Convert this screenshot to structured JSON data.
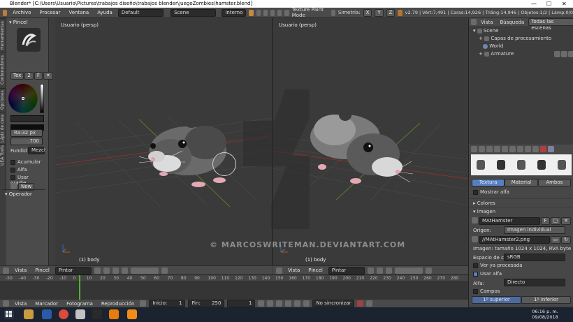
{
  "title_bar": {
    "text": "Blender* [C:\\Users\\Usuario\\Pictures\\trabajos diseño\\trabajos blender\\juegoZombies\\hamster.blend]",
    "minimize": "—",
    "maximize": "☐",
    "close": "✕"
  },
  "info_header": {
    "menus": [
      "Archivo",
      "Procesar",
      "Ventana",
      "Ayuda"
    ],
    "layout": "Default",
    "scene": "Scene",
    "engine": "Interno",
    "mode_label": "Texture Paint Mode",
    "symmetry_label": "Simetría:",
    "symmetry_axes": [
      "X",
      "Y",
      "Z"
    ],
    "stats": "v2.79 | Vért:7,491 | Caras:14,926 | Triáng:14,946 | Objetos:1/2 | Lámp:0/0"
  },
  "tool_shelf": {
    "vtabs": [
      "Herramientas",
      "Contenedores",
      "Opciones",
      "Lápiz de cera",
      "UEA Tools"
    ],
    "pincel_header": "Pincel",
    "tex_label": "Tex",
    "tex_num": "2",
    "tex_f": "F",
    "radius": "Ra:32 px",
    "strength": ".700",
    "blend_label": "Fundid",
    "blend_value": "Mezcl",
    "options": [
      {
        "label": "Acumular",
        "on": false
      },
      {
        "label": "Alfa",
        "on": false
      },
      {
        "label": "Usar gradie...",
        "on": false
      }
    ],
    "new_btn": "New",
    "operador_header": "Operador"
  },
  "viewport_left": {
    "label": "Usuario (persp)",
    "body": "(1) body",
    "header": {
      "view": "Vista",
      "brush": "Pincel",
      "mode": "Pintar Texturas"
    }
  },
  "viewport_right": {
    "label": "Usuario (persp)",
    "body": "(1) body",
    "header": {
      "view": "Vista",
      "brush": "Pincel",
      "mode": "Pintar Texturas"
    }
  },
  "watermark": "© MARCOSWRITEMAN.DEVIANTART.COM",
  "outliner": {
    "tabs": [
      "Vista",
      "Búsqueda",
      "Todas las escenas"
    ],
    "items": [
      {
        "label": "Scene",
        "indent": 0
      },
      {
        "label": "Capas de procesamiento",
        "indent": 1
      },
      {
        "label": "World",
        "indent": 1
      },
      {
        "label": "Armature",
        "indent": 1
      }
    ]
  },
  "properties": {
    "tabs": [
      "Textura",
      "Material",
      "Ambos"
    ],
    "show_alpha": "Mostrar alfa",
    "colors_panel": "Colores",
    "image_panel": "Imagen",
    "image_name": "MAtHamster",
    "image_f": "F",
    "source_label": "Origen:",
    "source_value": "Imagen individual",
    "file_path": "//MAtHamster2.png",
    "image_info": "Imagen: tamaño 1024 x 1024, RVA byte",
    "colorspace_label": "Espacio de co",
    "colorspace_value": "sRGB",
    "premultiplied": "Ver ya procesada",
    "use_alpha": "Usar alfa",
    "alpha_label": "Alfa:",
    "alpha_value": "Directo",
    "fields_label": "Campos",
    "field_upper": "1º superior",
    "field_lower": "1º inferior"
  },
  "timeline": {
    "ticks": [
      "-50",
      "-40",
      "-30",
      "-20",
      "-10",
      "0",
      "10",
      "20",
      "30",
      "40",
      "50",
      "60",
      "70",
      "80",
      "90",
      "100",
      "110",
      "120",
      "130",
      "140",
      "150",
      "160",
      "170",
      "180",
      "190",
      "200",
      "210",
      "220",
      "230",
      "240",
      "250",
      "260",
      "270",
      "280"
    ],
    "menus": [
      "Vista",
      "Marcador",
      "Fotograma",
      "Reproducción"
    ],
    "start": "Inicio:",
    "start_value": "1",
    "end": "Fin:",
    "end_value": "250",
    "current": "1",
    "sync": "No sincronizar"
  },
  "taskbar": {
    "time": "06:16 p. m.",
    "date": "09/08/2018"
  }
}
